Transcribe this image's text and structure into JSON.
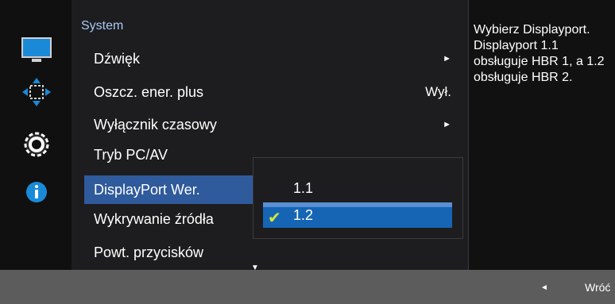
{
  "menu": {
    "title": "System",
    "items": [
      {
        "label": "Dźwięk",
        "value": "",
        "arrow": "►"
      },
      {
        "label": "Oszcz. ener. plus",
        "value": "Wył.",
        "arrow": ""
      },
      {
        "label": "Wyłącznik czasowy",
        "value": "",
        "arrow": "►"
      },
      {
        "label": "Tryb PC/AV",
        "value": "",
        "arrow": ""
      },
      {
        "label": "DisplayPort Wer.",
        "value": "",
        "arrow": ""
      },
      {
        "label": "Wykrywanie źródła",
        "value": "",
        "arrow": ""
      },
      {
        "label": "Powt. przycisków",
        "value": "",
        "arrow": ""
      }
    ],
    "scroll_down_glyph": "▼"
  },
  "submenu": {
    "options": [
      {
        "label": "1.1"
      },
      {
        "label": "1.2"
      }
    ],
    "check_glyph": "✔"
  },
  "help": {
    "text": "Wybierz Displayport. Displayport 1.1 obsługuje HBR 1, a 1.2 obsługuje HBR 2."
  },
  "footer": {
    "return_arrow": "◄",
    "return_label": "Wróć"
  },
  "sidebar_icons": [
    "display-icon",
    "move-arrows-icon",
    "gear-icon",
    "info-icon"
  ],
  "colors": {
    "selected_item": "#2f5a9c",
    "selected_option": "#1565b4",
    "checkmark": "#d6e63a",
    "title_text": "#a9c9f4",
    "bottom_bar": "#5c5c5c"
  }
}
